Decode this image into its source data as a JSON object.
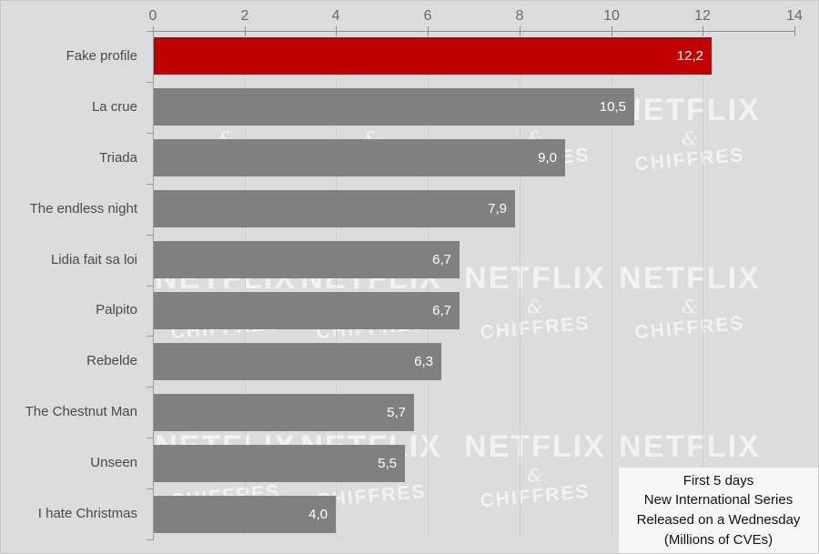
{
  "chart_data": {
    "type": "bar",
    "orientation": "horizontal",
    "title": "",
    "subtitle": "",
    "xlabel": "",
    "ylabel": "",
    "xlim": [
      0,
      14
    ],
    "ylim": null,
    "grid": true,
    "legend": null,
    "x_ticks": [
      "0",
      "2",
      "4",
      "6",
      "8",
      "10",
      "12",
      "14"
    ],
    "x_tick_values": [
      0,
      2,
      4,
      6,
      8,
      10,
      12,
      14
    ],
    "categories": [
      "Fake profile",
      "La crue",
      "Triada",
      "The endless night",
      "Lidia fait sa loi",
      "Palpito",
      "Rebelde",
      "The Chestnut Man",
      "Unseen",
      "I hate Christmas"
    ],
    "values": [
      12.2,
      10.5,
      9.0,
      7.9,
      6.7,
      6.7,
      6.3,
      5.7,
      5.5,
      4.0
    ],
    "value_labels": [
      "12,2",
      "10,5",
      "9,0",
      "7,9",
      "6,7",
      "6,7",
      "6,3",
      "5,7",
      "5,5",
      "4,0"
    ],
    "highlight_index": 0,
    "colors": {
      "highlight": "#c00000",
      "bar": "#808080",
      "background": "#dcdcdc",
      "gridline": "#cfcfcf",
      "axis": "#8c8c8c",
      "label_text": "#4a4a4a",
      "value_text": "#ffffff",
      "watermark": "#f2f2f2",
      "caption_background": "#f7f7f7",
      "caption_text": "#111111"
    },
    "annotations": [
      "First 5 days",
      "New International Series",
      "Released on a Wednesday",
      "(Millions of CVEs)"
    ]
  },
  "caption": {
    "line1": "First 5 days",
    "line2": "New International Series",
    "line3": "Released on a Wednesday",
    "line4": "(Millions of CVEs)"
  },
  "watermark": {
    "main": "NETFLIX",
    "amp": "&",
    "sub": "CHIFFRES"
  }
}
